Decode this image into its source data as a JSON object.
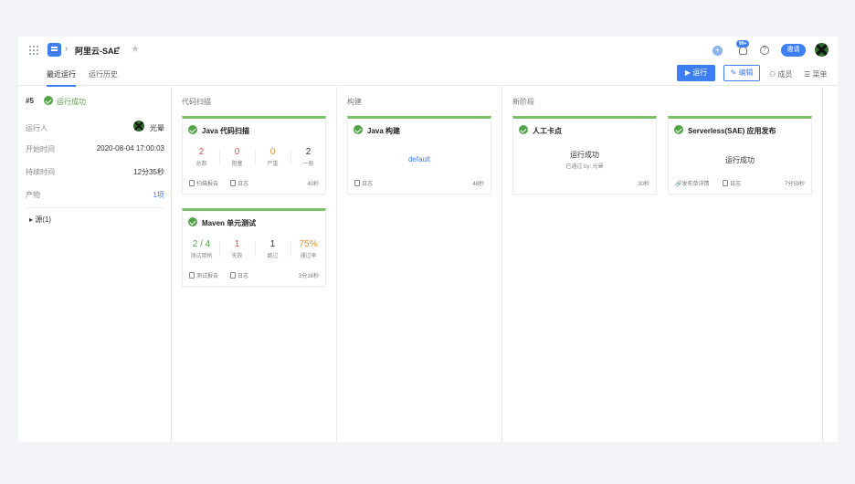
{
  "topbar": {
    "project_name": "阿里云-SAE",
    "crumb_sep": "›",
    "caret": "▾",
    "badge": "99+",
    "invite_label": "邀请"
  },
  "tabs": [
    {
      "label": "最近运行",
      "active": true
    },
    {
      "label": "运行历史",
      "active": false
    }
  ],
  "actions": {
    "run_label": "运行",
    "edit_label": "编辑",
    "members_label": "成员",
    "menu_label": "菜单"
  },
  "run": {
    "number": "#5",
    "status": "运行成功",
    "runner_label": "运行人",
    "runner_name": "光晕",
    "start_label": "开始时间",
    "start_value": "2020-08-04 17:00:03",
    "duration_label": "持续时间",
    "duration_value": "12分35秒",
    "artifact_label": "产物",
    "artifact_value": "1项",
    "source_label": "源(1)"
  },
  "stages": [
    {
      "title": "代码扫描"
    },
    {
      "title": "构建"
    },
    {
      "title": "新阶段"
    }
  ],
  "cards": {
    "scan": {
      "title": "Java 代码扫描",
      "metrics": [
        {
          "value": "2",
          "label": "总数",
          "color": "#d9534f"
        },
        {
          "value": "0",
          "label": "阻塞",
          "color": "#d9534f"
        },
        {
          "value": "0",
          "label": "严重",
          "color": "#e8923a"
        },
        {
          "value": "2",
          "label": "一般",
          "color": "#333333"
        }
      ],
      "report_label": "扫描报告",
      "log_label": "日志",
      "duration": "40秒"
    },
    "maven": {
      "title": "Maven 单元测试",
      "metrics": [
        {
          "value": "2 / 4",
          "label": "测试用例",
          "color": "#52a547"
        },
        {
          "value": "1",
          "label": "失败",
          "color": "#d9534f"
        },
        {
          "value": "1",
          "label": "跳过",
          "color": "#333333"
        },
        {
          "value": "75%",
          "label": "通过率",
          "color": "#e8923a"
        }
      ],
      "report_label": "测试报告",
      "log_label": "日志",
      "duration": "3分16秒"
    },
    "build": {
      "title": "Java 构建",
      "center": "default",
      "log_label": "日志",
      "duration": "48秒"
    },
    "manual": {
      "title": "人工卡点",
      "center": "运行成功",
      "sub": "已通过 by: 光晕",
      "duration": "30秒"
    },
    "deploy": {
      "title": "Serverless(SAE) 应用发布",
      "center": "运行成功",
      "detail_label": "发布单详情",
      "log_label": "日志",
      "duration": "7分59秒"
    }
  }
}
